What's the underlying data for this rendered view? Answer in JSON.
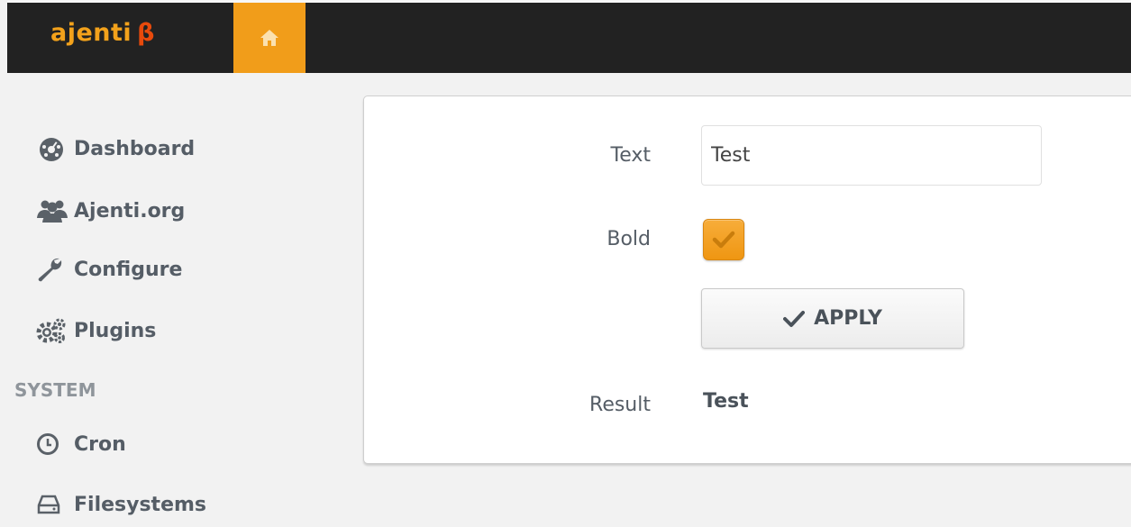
{
  "app": {
    "logo_text": "ajenti",
    "logo_beta": "β",
    "brand_color": "#f19d1a",
    "home_icon": "home-icon"
  },
  "sidebar": {
    "items": [
      {
        "label": "Dashboard",
        "icon": "dashboard-icon"
      },
      {
        "label": "Ajenti.org",
        "icon": "users-icon"
      },
      {
        "label": "Configure",
        "icon": "wrench-icon"
      },
      {
        "label": "Plugins",
        "icon": "gears-icon"
      }
    ],
    "section_system": "SYSTEM",
    "system_items": [
      {
        "label": "Cron",
        "icon": "clock-icon"
      },
      {
        "label": "Filesystems",
        "icon": "hdd-icon"
      }
    ]
  },
  "form": {
    "text_label": "Text",
    "text_value": "Test",
    "bold_label": "Bold",
    "bold_checked": true,
    "apply_label": "APPLY",
    "result_label": "Result",
    "result_value": "Test"
  }
}
